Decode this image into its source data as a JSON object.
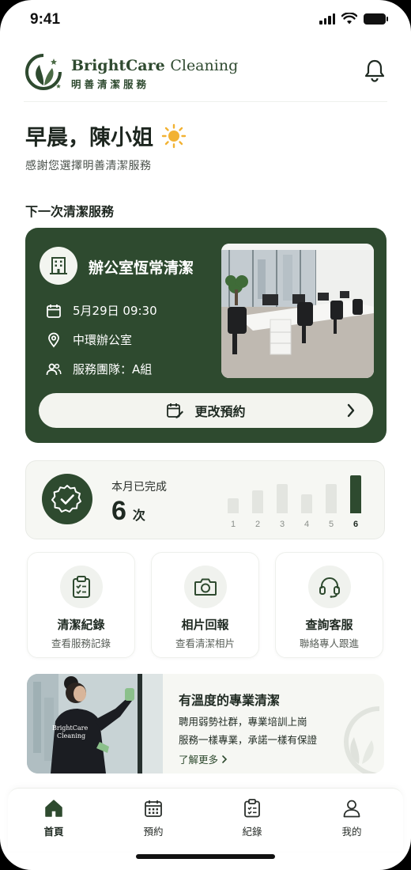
{
  "status_bar": {
    "time": "9:41"
  },
  "header": {
    "brand_primary": "BrightCare",
    "brand_secondary": "Cleaning",
    "brand_cn": "明善清潔服務",
    "icons": {
      "logo": "leaf-logo-icon",
      "notifications": "bell-icon"
    }
  },
  "greeting": {
    "title": "早晨，陳小姐",
    "icon": "sun-icon",
    "subtitle": "感謝您選擇明善清潔服務"
  },
  "next_service": {
    "section_title": "下一次清潔服務",
    "service_name": "辦公室恆常清潔",
    "service_icon": "building-icon",
    "details": [
      {
        "icon": "calendar-icon",
        "text": "5月29日 09:30"
      },
      {
        "icon": "location-pin-icon",
        "text": "中環辦公室"
      },
      {
        "icon": "team-icon",
        "text": "服務團隊：A組"
      }
    ],
    "change_button": "更改預約",
    "accent": "#2e4a2f"
  },
  "monthly_stats": {
    "label": "本月已完成",
    "count": "6",
    "unit": "次",
    "icon": "check-badge-icon"
  },
  "chart_data": {
    "type": "bar",
    "categories": [
      "1",
      "2",
      "3",
      "4",
      "5",
      "6"
    ],
    "values": [
      1.8,
      2.8,
      3.6,
      2.3,
      3.6,
      4.6
    ],
    "ylim": [
      0,
      5
    ],
    "highlight_index": 5
  },
  "quick_actions": [
    {
      "title": "清潔紀錄",
      "subtitle": "查看服務記錄",
      "icon": "clipboard-check-icon"
    },
    {
      "title": "相片回報",
      "subtitle": "查看清潔相片",
      "icon": "camera-icon"
    },
    {
      "title": "查詢客服",
      "subtitle": "聯絡專人跟進",
      "icon": "headset-icon"
    }
  ],
  "promo": {
    "title": "有溫度的專業清潔",
    "line1": "聘用弱勢社群，專業培訓上崗",
    "line2": "服務一樣專業，承諾一樣有保證",
    "more": "了解更多",
    "shirt_text_1": "BrightCare",
    "shirt_text_2": "Cleaning"
  },
  "tab_bar": [
    {
      "label": "首頁",
      "icon": "home-icon",
      "active": true
    },
    {
      "label": "預約",
      "icon": "calendar-icon",
      "active": false
    },
    {
      "label": "紀錄",
      "icon": "clipboard-icon",
      "active": false
    },
    {
      "label": "我的",
      "icon": "user-icon",
      "active": false
    }
  ]
}
